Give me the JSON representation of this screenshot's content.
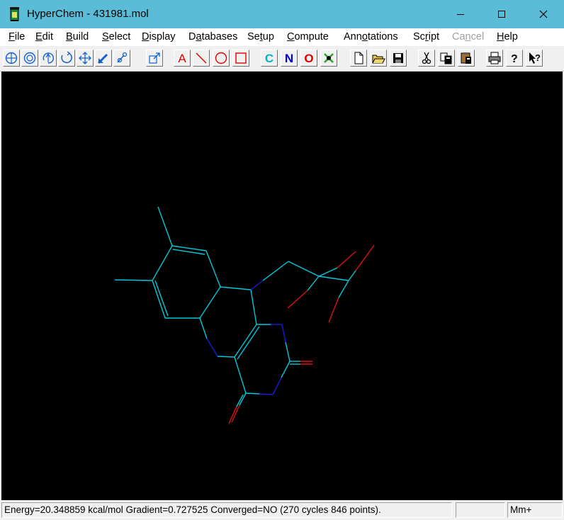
{
  "window": {
    "title": "HyperChem - 431981.mol",
    "app_icon": "hyperchem-flask-icon",
    "controls": [
      "minimize-icon",
      "maximize-icon",
      "close-icon"
    ]
  },
  "menu": {
    "file": {
      "pre": "",
      "key": "F",
      "post": "ile"
    },
    "edit": {
      "pre": "",
      "key": "E",
      "post": "dit"
    },
    "build": {
      "pre": "",
      "key": "B",
      "post": "uild"
    },
    "select": {
      "pre": "",
      "key": "S",
      "post": "elect"
    },
    "display": {
      "pre": "",
      "key": "D",
      "post": "isplay"
    },
    "databases": {
      "pre": "D",
      "key": "a",
      "post": "tabases"
    },
    "setup": {
      "pre": "Se",
      "key": "t",
      "post": "up"
    },
    "compute": {
      "pre": "",
      "key": "C",
      "post": "ompute"
    },
    "annotations": {
      "pre": "Ann",
      "key": "o",
      "post": "tations"
    },
    "script": {
      "pre": "Sc",
      "key": "r",
      "post": "ipt"
    },
    "cancel": {
      "pre": "Ca",
      "key": "n",
      "post": "cel"
    },
    "help": {
      "pre": "",
      "key": "H",
      "post": "elp"
    }
  },
  "toolbar": {
    "tools": [
      {
        "name": "xy-rotation-tool-icon"
      },
      {
        "name": "z-rotation-tool-icon"
      },
      {
        "name": "xy-translation-icon"
      },
      {
        "name": "z-rotation-circle-icon"
      },
      {
        "name": "translate-cross-icon"
      },
      {
        "name": "magnify-tool-icon"
      },
      {
        "name": "drawing-tool-icon"
      },
      {
        "name": "zoom-box-icon"
      },
      {
        "name": "text-annotation-icon",
        "letter": "A",
        "color": "#e00000"
      },
      {
        "name": "line-annotation-icon",
        "color": "#e00000"
      },
      {
        "name": "ellipse-annotation-icon",
        "color": "#e00000"
      },
      {
        "name": "rectangle-annotation-icon",
        "color": "#e00000"
      },
      {
        "name": "carbon-element-button",
        "letter": "C",
        "color": "#00b4c8"
      },
      {
        "name": "nitrogen-element-button",
        "letter": "N",
        "color": "#0000d0"
      },
      {
        "name": "oxygen-element-button",
        "letter": "O",
        "color": "#e00000"
      },
      {
        "name": "select-element-icon"
      },
      {
        "name": "new-file-icon"
      },
      {
        "name": "open-file-icon"
      },
      {
        "name": "save-file-icon"
      },
      {
        "name": "cut-icon"
      },
      {
        "name": "copy-icon"
      },
      {
        "name": "paste-icon"
      },
      {
        "name": "print-icon"
      },
      {
        "name": "help-icon"
      },
      {
        "name": "context-help-icon"
      }
    ]
  },
  "colors": {
    "titlebar": "#5bbcd7",
    "canvas_background": "#000000",
    "carbon": "#00c8d8",
    "nitrogen": "#1a1ad8",
    "oxygen": "#e01010"
  },
  "status": {
    "message": "Energy=20.348859 kcal/mol Gradient=0.727525 Converged=NO (270 cycles 846 points).",
    "blank_panel": "",
    "mode": "Mm+"
  }
}
